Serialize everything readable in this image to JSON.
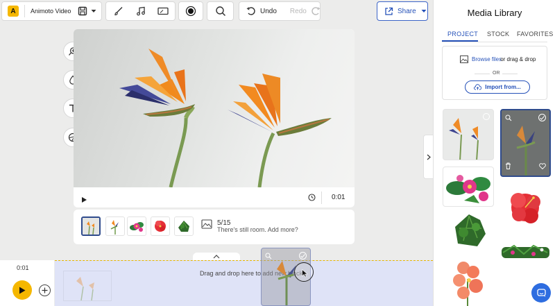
{
  "toolbar": {
    "app_title": "Animoto Video",
    "undo_label": "Undo",
    "redo_label": "Redo",
    "share_label": "Share"
  },
  "preview": {
    "time": "0:01"
  },
  "storyboard": {
    "count": "5/15",
    "hint": "There's still room. Add more?"
  },
  "timeline": {
    "time": "0:01",
    "drop_text": "Drag and drop here to add new blocks"
  },
  "media_library": {
    "title": "Media Library",
    "tabs": [
      "PROJECT",
      "STOCK",
      "FAVORITES"
    ],
    "active_tab": "PROJECT",
    "browse_link": "Browse files",
    "browse_suffix": " or drag & drop",
    "or": "OR",
    "import_label": "Import from..."
  },
  "colors": {
    "brand_yellow": "#f5b700",
    "accent_blue": "#2450b8",
    "selected_border": "#2f4b8c",
    "drop_zone": "#dfe3f7",
    "chat_button": "#2e6de0"
  }
}
